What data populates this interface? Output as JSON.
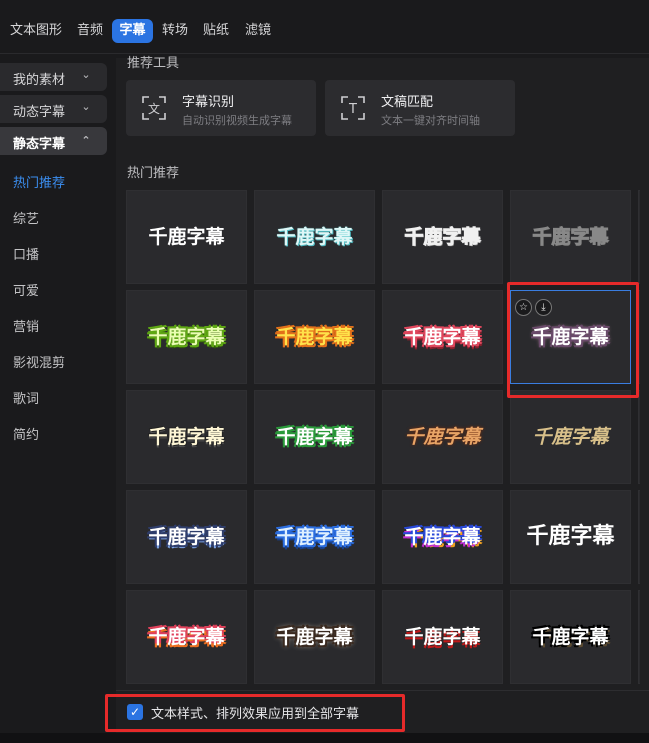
{
  "top_tabs": [
    {
      "label": "文本图形",
      "active": false
    },
    {
      "label": "音频",
      "active": false
    },
    {
      "label": "字幕",
      "active": true
    },
    {
      "label": "转场",
      "active": false
    },
    {
      "label": "贴纸",
      "active": false
    },
    {
      "label": "滤镜",
      "active": false
    }
  ],
  "sidebar": {
    "groups": [
      {
        "label": "我的素材",
        "expanded": false
      },
      {
        "label": "动态字幕",
        "expanded": false
      },
      {
        "label": "静态字幕",
        "expanded": true
      }
    ],
    "items": [
      {
        "label": "热门推荐",
        "active": true
      },
      {
        "label": "综艺",
        "active": false
      },
      {
        "label": "口播",
        "active": false
      },
      {
        "label": "可爱",
        "active": false
      },
      {
        "label": "营销",
        "active": false
      },
      {
        "label": "影视混剪",
        "active": false
      },
      {
        "label": "歌词",
        "active": false
      },
      {
        "label": "简约",
        "active": false
      }
    ]
  },
  "tools": {
    "title": "推荐工具",
    "items": [
      {
        "name": "字幕识别",
        "desc": "自动识别视频生成字幕",
        "icon": "subtitle-recognition-icon"
      },
      {
        "name": "文稿匹配",
        "desc": "文本一键对齐时间轴",
        "icon": "script-match-icon"
      }
    ]
  },
  "hot": {
    "title": "热门推荐",
    "sample_text": "千鹿字幕",
    "styles": [
      "s-white",
      "s-cyan",
      "s-outline",
      "s-chrome",
      "s-lime",
      "s-orange",
      "s-pink",
      "s-pinkwhite",
      "s-cream",
      "s-green",
      "s-amber",
      "s-gold",
      "s-blueout",
      "s-bluefill",
      "s-rainbow",
      "s-bigwhite",
      "s-redglow",
      "s-beige",
      "s-redbase",
      "s-darkout"
    ],
    "selected_index": 7,
    "hover_icons": [
      "star-icon",
      "download-icon"
    ]
  },
  "footer": {
    "checkbox_checked": true,
    "checkbox_label": "文本样式、排列效果应用到全部字幕"
  },
  "accent_color": "#2b74e2",
  "highlight_color": "#e62a2a"
}
